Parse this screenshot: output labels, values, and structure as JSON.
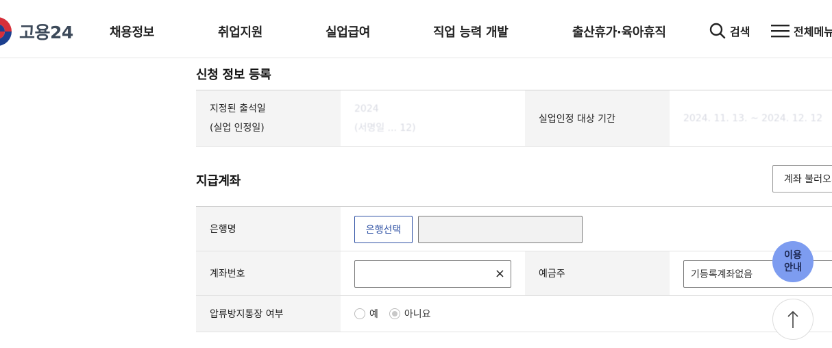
{
  "header": {
    "logo_text": "고용24",
    "nav": [
      "채용정보",
      "취업지원",
      "실업급여",
      "직업 능력 개발",
      "출산휴가·육아휴직"
    ],
    "search_label": "검색",
    "menu_label": "전체메뉴"
  },
  "apply_section": {
    "title": "신청 정보 등록",
    "attend_label_1": "지정된 출석일",
    "attend_label_2": "(실업 인정일)",
    "attend_value_1": "2024",
    "attend_value_2": "(서명일 ... 12)",
    "period_label": "실업인정 대상 기간",
    "period_value": "2024. 11. 13. ~ 2024. 12. 12"
  },
  "account_section": {
    "title": "지급계좌",
    "load_button": "계좌 불러오기",
    "bank_label": "은행명",
    "bank_select_button": "은행선택",
    "account_number_label": "계좌번호",
    "account_number_value": "",
    "holder_label": "예금주",
    "holder_value": "기등록계좌없음",
    "seizure_label": "압류방지통장 여부",
    "radio_yes": "예",
    "radio_no": "아니요"
  },
  "floating": {
    "guide_line1": "이용",
    "guide_line2": "안내"
  }
}
